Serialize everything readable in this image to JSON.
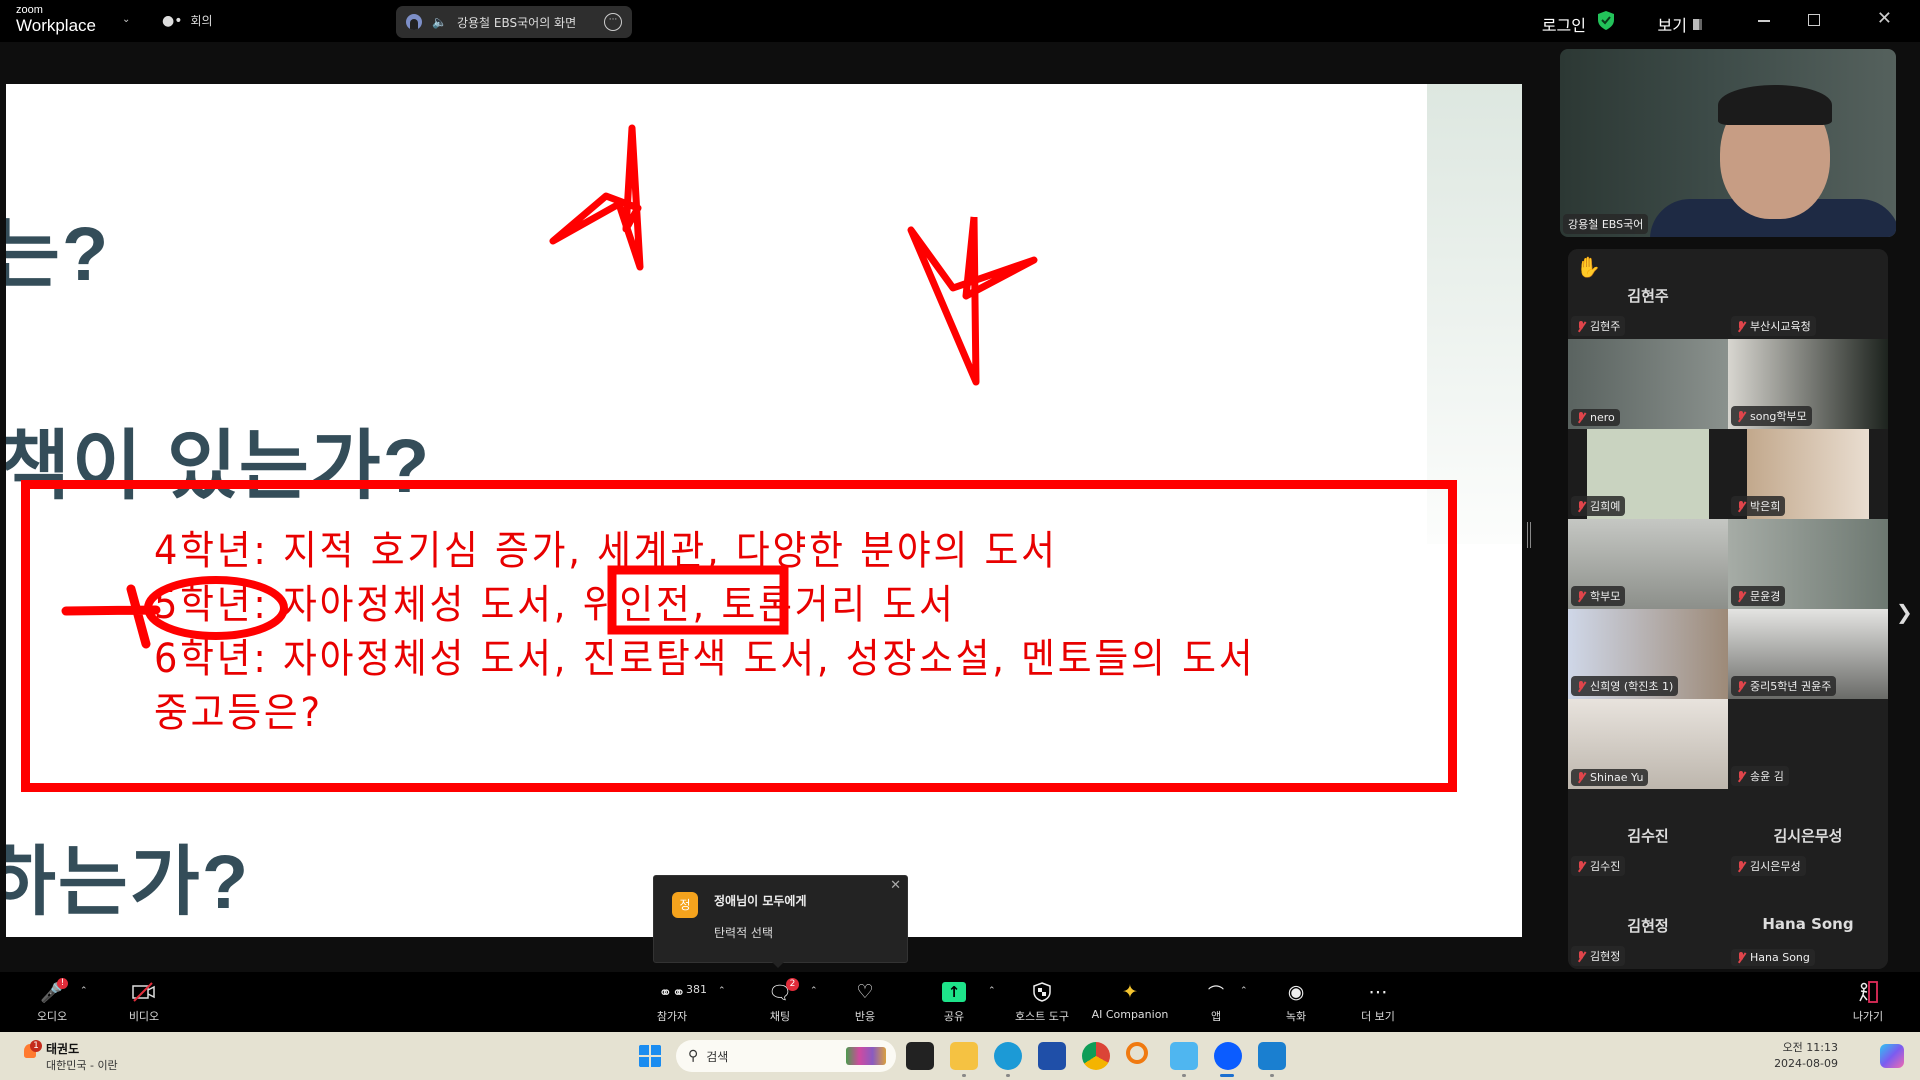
{
  "titlebar": {
    "brand_small": "zoom",
    "brand_big": "Workplace",
    "meeting_label": "회의",
    "share_chip_label": "강용철 EBS국어의 화면",
    "login_label": "로그인",
    "view_label": "보기"
  },
  "slide": {
    "heading_1": "는?",
    "heading_2": "책이  있는가?",
    "heading_3": "하는가?",
    "lines": [
      "4학년: 지적 호기심 증가, 세계관, 다양한 분야의 도서",
      "5학년: 자아정체성 도서, 위인전, 토론거리 도서",
      "6학년: 자아정체성 도서, 진로탐색 도서, 성장소설, 멘토들의 도서",
      "중고등은?"
    ],
    "annotation_color": "#ff0000",
    "text_color": "#e80000",
    "heading_color": "#344d59"
  },
  "speaker": {
    "name": "강용철 EBS국어"
  },
  "gallery": {
    "tiles": [
      {
        "name": "김현주",
        "center_name": "김현주",
        "hand_raised": true,
        "video": false
      },
      {
        "name": "부산시교육청",
        "video": false,
        "logo": true
      },
      {
        "name": "nero",
        "video": true
      },
      {
        "name": "song학부모",
        "video": true
      },
      {
        "name": "김희예",
        "video": true
      },
      {
        "name": "박은희",
        "video": true
      },
      {
        "name": "학부모",
        "video": true
      },
      {
        "name": "문윤경",
        "video": true
      },
      {
        "name": "신희영 (학진초 1)",
        "video": true
      },
      {
        "name": "중리5학년 권윤주",
        "video": true
      },
      {
        "name": "Shinae Yu",
        "video": true
      },
      {
        "name": "송윤 김",
        "video": true
      },
      {
        "name": "김수진",
        "center_name": "김수진",
        "video": false
      },
      {
        "name": "김시은무성",
        "center_name": "김시은무성",
        "video": false
      },
      {
        "name": "김현정",
        "center_name": "김현정",
        "video": false
      },
      {
        "name": "Hana Song",
        "center_name": "Hana Song",
        "video": false
      }
    ]
  },
  "toast": {
    "avatar_letter": "정",
    "title": "정애님이 모두에게",
    "message": "탄력적 선택"
  },
  "toolbar": {
    "audio": "오디오",
    "video": "비디오",
    "participants": "참가자",
    "participants_count": "381",
    "chat": "채팅",
    "chat_badge": "2",
    "reactions": "반응",
    "share": "공유",
    "host_tools": "호스트 도구",
    "ai_companion": "AI Companion",
    "apps": "앱",
    "record": "녹화",
    "more": "더 보기",
    "leave": "나가기"
  },
  "taskbar": {
    "weather_title": "태권도",
    "weather_sub": "대한민국 - 이란",
    "weather_badge": "1",
    "search_placeholder": "검색",
    "time": "오전 11:13",
    "date": "2024-08-09"
  }
}
